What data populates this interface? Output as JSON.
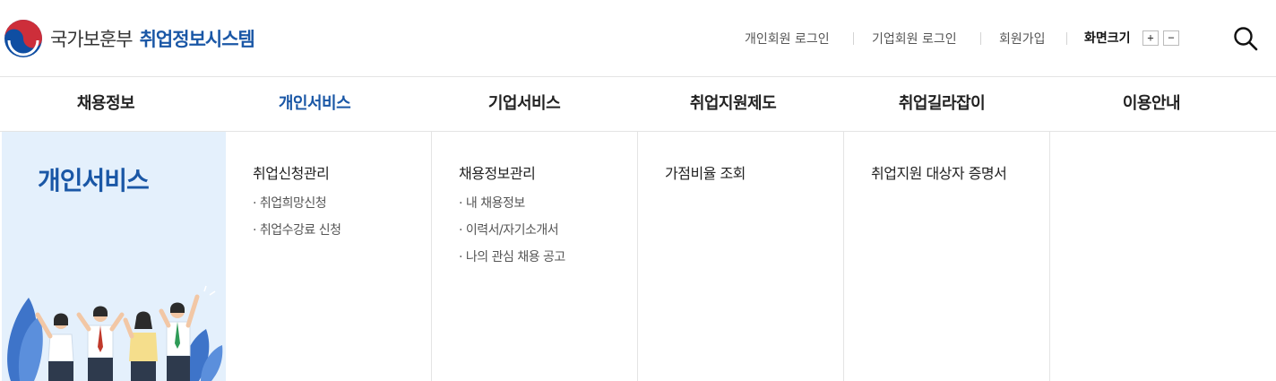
{
  "header": {
    "ministry": "국가보훈부",
    "system": "취업정보시스템",
    "logo_icon": "taegeuk-logo-icon",
    "util_links": [
      "개인회원 로그인",
      "기업회원 로그인",
      "회원가입"
    ],
    "font_size_label": "화면크기",
    "font_increase": "+",
    "font_decrease": "−",
    "search_icon": "search-icon"
  },
  "nav": {
    "items": [
      "채용정보",
      "개인서비스",
      "기업서비스",
      "취업지원제도",
      "취업길라잡이",
      "이용안내"
    ],
    "active_index": 1
  },
  "dropdown": {
    "section_title": "개인서비스",
    "columns": [
      {
        "title": "취업신청관리",
        "items": [
          "· 취업희망신청",
          "· 취업수강료 신청"
        ]
      },
      {
        "title": "채용정보관리",
        "items": [
          "· 내 채용정보",
          "· 이력서/자기소개서",
          "· 나의 관심 채용 공고"
        ]
      },
      {
        "title": "가점비율 조회",
        "items": []
      },
      {
        "title": "취업지원 대상자 증명서",
        "items": []
      }
    ]
  },
  "colors": {
    "accent": "#1a57a6",
    "panel_bg": "#e4f0fc",
    "border": "#e4e4e4",
    "logo_red": "#cd2e3a",
    "logo_blue": "#0f4ea2"
  }
}
